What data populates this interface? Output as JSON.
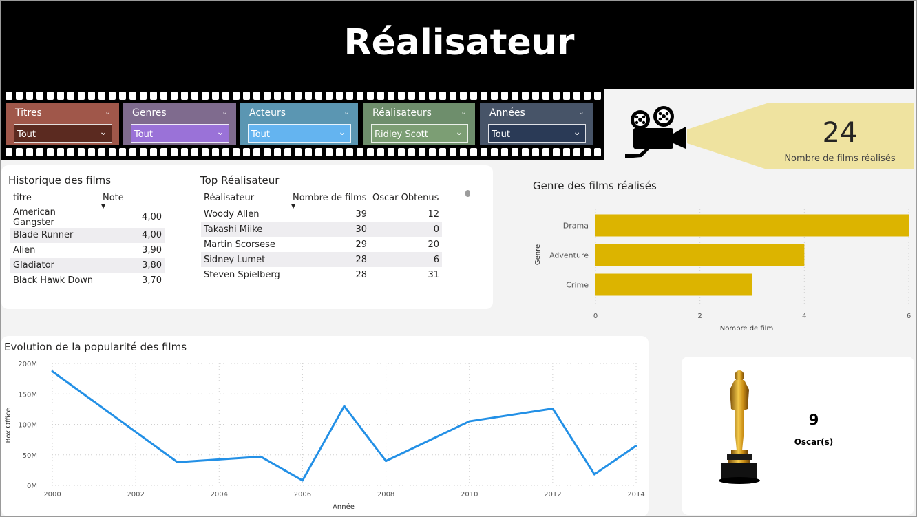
{
  "header": {
    "title": "Réalisateur"
  },
  "slicers": [
    {
      "label": "Titres",
      "value": "Tout",
      "color": "#a0574a",
      "box_color": "#5b2a20"
    },
    {
      "label": "Genres",
      "value": "Tout",
      "color": "#7f6b8e",
      "box_color": "#9a72d8"
    },
    {
      "label": "Acteurs",
      "value": "Tout",
      "color": "#5b96b2",
      "box_color": "#64b4f0"
    },
    {
      "label": "Réalisateurs",
      "value": "Ridley Scott",
      "color": "#6e8e6c",
      "box_color": "#7c9e74"
    },
    {
      "label": "Années",
      "value": "Tout",
      "color": "#475468",
      "box_color": "#2a3a56"
    }
  ],
  "directors_card": {
    "value": "24",
    "label": "Nombre de films réalisés",
    "icon": "film-camera-icon",
    "beam_color": "#efe3a0"
  },
  "history_table": {
    "title": "Historique des films",
    "columns": [
      "titre",
      "Note"
    ],
    "rows": [
      [
        "American Gangster",
        "4,00"
      ],
      [
        "Blade Runner",
        "4,00"
      ],
      [
        "Alien",
        "3,90"
      ],
      [
        "Gladiator",
        "3,80"
      ],
      [
        "Black Hawk Down",
        "3,70"
      ]
    ]
  },
  "top_directors_table": {
    "title": "Top Réalisateur",
    "columns": [
      "Réalisateur",
      "Nombre de films",
      "Oscar Obtenus"
    ],
    "rows": [
      [
        "Woody Allen",
        "39",
        "12"
      ],
      [
        "Takashi Miike",
        "30",
        "0"
      ],
      [
        "Martin Scorsese",
        "29",
        "20"
      ],
      [
        "Sidney Lumet",
        "28",
        "6"
      ],
      [
        "Steven Spielberg",
        "28",
        "31"
      ]
    ]
  },
  "chart_data": [
    {
      "type": "bar",
      "orientation": "horizontal",
      "title": "Genre des films réalisés",
      "categories": [
        "Drama",
        "Adventure",
        "Crime"
      ],
      "values": [
        6,
        4,
        3
      ],
      "xlabel": "Nombre de film",
      "ylabel": "Genre",
      "xlim": [
        0,
        6
      ],
      "xticks": [
        "0",
        "2",
        "4",
        "6"
      ],
      "color": "#dcb400",
      "grid": true
    },
    {
      "type": "line",
      "title": "Evolution de la popularité des films",
      "x": [
        2000,
        2003,
        2005,
        2006,
        2007,
        2008,
        2010,
        2012,
        2013,
        2014
      ],
      "y": [
        187,
        38,
        47,
        8,
        130,
        40,
        105,
        126,
        18,
        65
      ],
      "y_unit": "M",
      "xlabel": "Année",
      "ylabel": "Box Office",
      "xlim": [
        2000,
        2014
      ],
      "ylim": [
        0,
        200
      ],
      "xticks": [
        "2000",
        "2002",
        "2004",
        "2006",
        "2008",
        "2010",
        "2012",
        "2014"
      ],
      "yticks": [
        "0M",
        "50M",
        "100M",
        "150M",
        "200M"
      ],
      "color": "#2390e6",
      "grid": true
    }
  ],
  "oscar_card": {
    "value": "9",
    "label": "Oscar(s)",
    "icon": "oscar-statuette-icon"
  }
}
